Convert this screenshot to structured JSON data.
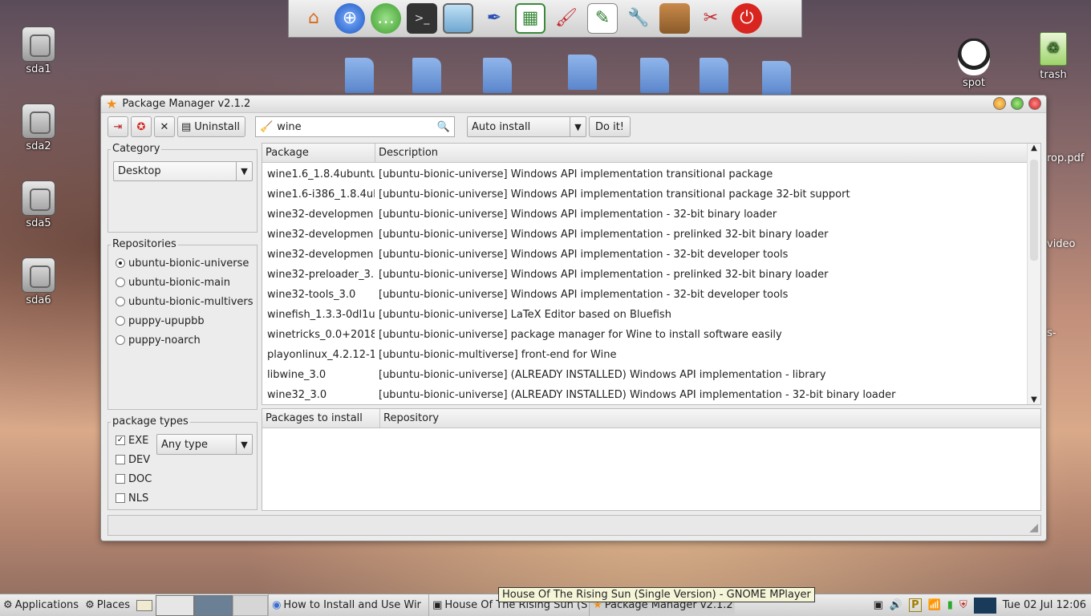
{
  "desktop": {
    "drives": [
      {
        "label": "sda1"
      },
      {
        "label": "sda2"
      },
      {
        "label": "sda5"
      },
      {
        "label": "sda6"
      }
    ],
    "spot_label": "spot",
    "trash_label": "trash",
    "partial_labels": [
      "rop.pdf",
      "video",
      "s-"
    ]
  },
  "launcher": {
    "icons": [
      "home-icon",
      "globe-icon",
      "chat-icon",
      "terminal-icon",
      "monitor-icon",
      "pen-icon",
      "spreadsheet-icon",
      "paint-icon",
      "notepad-icon",
      "wrench-icon",
      "package-icon",
      "tools-icon",
      "power-icon"
    ]
  },
  "window": {
    "title": "Package Manager v2.1.2",
    "toolbar": {
      "uninstall_label": "Uninstall",
      "search_value": "wine",
      "action_value": "Auto install",
      "doit_label": "Do it!"
    },
    "category": {
      "label": "Category",
      "value": "Desktop"
    },
    "repositories": {
      "label": "Repositories",
      "items": [
        {
          "name": "ubuntu-bionic-universe",
          "selected": true
        },
        {
          "name": "ubuntu-bionic-main",
          "selected": false
        },
        {
          "name": "ubuntu-bionic-multivers",
          "selected": false
        },
        {
          "name": "puppy-upupbb",
          "selected": false
        },
        {
          "name": "puppy-noarch",
          "selected": false
        }
      ]
    },
    "package_types": {
      "label": "package types",
      "type_value": "Any type",
      "checks": [
        {
          "name": "EXE",
          "checked": true
        },
        {
          "name": "DEV",
          "checked": false
        },
        {
          "name": "DOC",
          "checked": false
        },
        {
          "name": "NLS",
          "checked": false
        }
      ]
    },
    "packages": {
      "headers": [
        "Package",
        "Description"
      ],
      "rows": [
        {
          "package": "wine1.6_1.8.4ubuntu",
          "description": "[ubuntu-bionic-universe] Windows API implementation transitional package"
        },
        {
          "package": "wine1.6-i386_1.8.4ul",
          "description": "[ubuntu-bionic-universe] Windows API implementation transitional package 32-bit support"
        },
        {
          "package": "wine32-developmen",
          "description": "[ubuntu-bionic-universe] Windows API implementation - 32-bit binary loader"
        },
        {
          "package": "wine32-developmen",
          "description": "[ubuntu-bionic-universe] Windows API implementation - prelinked 32-bit binary loader"
        },
        {
          "package": "wine32-developmen",
          "description": "[ubuntu-bionic-universe] Windows API implementation - 32-bit developer tools"
        },
        {
          "package": "wine32-preloader_3.",
          "description": "[ubuntu-bionic-universe] Windows API implementation - prelinked 32-bit binary loader"
        },
        {
          "package": "wine32-tools_3.0",
          "description": "[ubuntu-bionic-universe] Windows API implementation - 32-bit developer tools"
        },
        {
          "package": "winefish_1.3.3-0dl1u",
          "description": "[ubuntu-bionic-universe] LaTeX Editor based on Bluefish"
        },
        {
          "package": "winetricks_0.0+2018",
          "description": "[ubuntu-bionic-universe] package manager for Wine to install software easily"
        },
        {
          "package": "playonlinux_4.2.12-1",
          "description": "[ubuntu-bionic-multiverse] front-end for Wine"
        },
        {
          "package": "libwine_3.0",
          "description": "[ubuntu-bionic-universe] (ALREADY INSTALLED) Windows API implementation - library"
        },
        {
          "package": "wine32_3.0",
          "description": "[ubuntu-bionic-universe] (ALREADY INSTALLED) Windows API implementation - 32-bit binary loader"
        }
      ]
    },
    "install_list": {
      "headers": [
        "Packages to install",
        "Repository"
      ]
    }
  },
  "taskbar": {
    "applications_label": "Applications",
    "places_label": "Places",
    "tasks": [
      "How to Install and Use Wir",
      "House Of The Rising Sun (S",
      "Package Manager v2.1.2"
    ],
    "tooltip": "House Of The Rising Sun (Single Version) - GNOME MPlayer",
    "clock": "Tue 02 Jul 12:06"
  }
}
